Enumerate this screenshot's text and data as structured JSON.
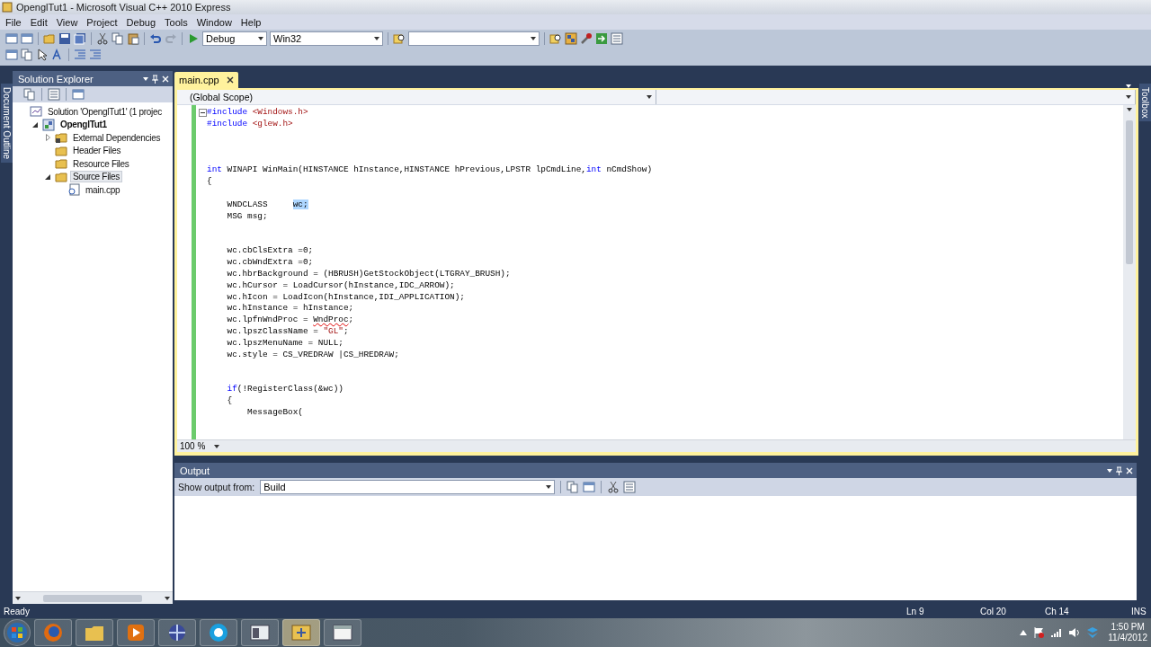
{
  "window": {
    "title": "OpenglTut1 - Microsoft Visual C++ 2010 Express"
  },
  "menu": [
    "File",
    "Edit",
    "View",
    "Project",
    "Debug",
    "Tools",
    "Window",
    "Help"
  ],
  "toolbar": {
    "configuration": "Debug",
    "platform": "Win32"
  },
  "side_tab_left": "Document Outline",
  "side_tab_right": "Toolbox",
  "solution_explorer": {
    "title": "Solution Explorer",
    "tree": [
      {
        "label": "Solution 'OpenglTut1' (1 projec",
        "kind": "solution",
        "selected": false,
        "children": [
          {
            "label": "OpenglTut1",
            "kind": "project",
            "expanded": true,
            "selected": false,
            "children": [
              {
                "label": "External Dependencies",
                "kind": "dependencies",
                "expanded": false,
                "selected": false
              },
              {
                "label": "Header Files",
                "kind": "folder",
                "selected": false
              },
              {
                "label": "Resource Files",
                "kind": "folder",
                "selected": false
              },
              {
                "label": "Source Files",
                "kind": "folder",
                "expanded": true,
                "selected": true,
                "children": [
                  {
                    "label": "main.cpp",
                    "kind": "file",
                    "selected": false
                  }
                ]
              }
            ]
          }
        ]
      }
    ]
  },
  "editor": {
    "tabs": [
      {
        "label": "main.cpp",
        "selected": true
      }
    ],
    "scope": "(Global Scope)",
    "zoom": "100 %",
    "lines": [
      {
        "kind": "code",
        "expanded": true,
        "tokens": [
          {
            "text": "#include",
            "kind": "keyword"
          },
          {
            "text": " <Windows.h>",
            "kind": "string"
          }
        ]
      },
      {
        "kind": "code",
        "tokens": [
          {
            "text": "#include",
            "kind": "keyword"
          },
          {
            "text": " <glew.h>",
            "kind": "string"
          }
        ]
      },
      {
        "kind": "blank"
      },
      {
        "kind": "blank"
      },
      {
        "kind": "blank"
      },
      {
        "kind": "code",
        "tokens": [
          {
            "text": "int",
            "kind": "keyword"
          },
          {
            "text": " WINAPI WinMain(HINSTANCE hInstance,HINSTANCE hPrevious,LPSTR lpCmdLine,",
            "kind": "plain"
          },
          {
            "text": "int",
            "kind": "keyword"
          },
          {
            "text": " nCmdShow)",
            "kind": "plain"
          }
        ]
      },
      {
        "kind": "code",
        "tokens": [
          {
            "text": "{",
            "kind": "plain"
          }
        ]
      },
      {
        "kind": "blank"
      },
      {
        "kind": "code",
        "tokens": [
          {
            "text": "    WNDCLASS     ",
            "kind": "plain"
          },
          {
            "text": "wc;",
            "kind": "selected"
          }
        ]
      },
      {
        "kind": "code",
        "tokens": [
          {
            "text": "    MSG msg;",
            "kind": "plain"
          }
        ]
      },
      {
        "kind": "blank"
      },
      {
        "kind": "blank"
      },
      {
        "kind": "code",
        "tokens": [
          {
            "text": "    wc.cbClsExtra =0;",
            "kind": "plain"
          }
        ]
      },
      {
        "kind": "code",
        "tokens": [
          {
            "text": "    wc.cbWndExtra =0;",
            "kind": "plain"
          }
        ]
      },
      {
        "kind": "code",
        "tokens": [
          {
            "text": "    wc.hbrBackground = (HBRUSH)GetStockObject(LTGRAY_BRUSH);",
            "kind": "plain"
          }
        ]
      },
      {
        "kind": "code",
        "tokens": [
          {
            "text": "    wc.hCursor = LoadCursor(hInstance,IDC_ARROW);",
            "kind": "plain"
          }
        ]
      },
      {
        "kind": "code",
        "tokens": [
          {
            "text": "    wc.hIcon = LoadIcon(hInstance,IDI_APPLICATION);",
            "kind": "plain"
          }
        ]
      },
      {
        "kind": "code",
        "tokens": [
          {
            "text": "    wc.hInstance = hInstance;",
            "kind": "plain"
          }
        ]
      },
      {
        "kind": "code",
        "tokens": [
          {
            "text": "    wc.lpfnWndProc = ",
            "kind": "plain"
          },
          {
            "text": "WndProc",
            "kind": "error"
          },
          {
            "text": ";",
            "kind": "plain"
          }
        ]
      },
      {
        "kind": "code",
        "tokens": [
          {
            "text": "    wc.lpszClassName = ",
            "kind": "plain"
          },
          {
            "text": "\"GL\"",
            "kind": "string"
          },
          {
            "text": ";",
            "kind": "plain"
          }
        ]
      },
      {
        "kind": "code",
        "tokens": [
          {
            "text": "    wc.lpszMenuName = NULL;",
            "kind": "plain"
          }
        ]
      },
      {
        "kind": "code",
        "tokens": [
          {
            "text": "    wc.style = CS_VREDRAW |CS_HREDRAW;",
            "kind": "plain"
          }
        ]
      },
      {
        "kind": "blank"
      },
      {
        "kind": "blank"
      },
      {
        "kind": "code",
        "tokens": [
          {
            "text": "    if",
            "kind": "keyword"
          },
          {
            "text": "(!RegisterClass(&wc))",
            "kind": "plain"
          }
        ]
      },
      {
        "kind": "code",
        "tokens": [
          {
            "text": "    {",
            "kind": "plain"
          }
        ]
      },
      {
        "kind": "code",
        "tokens": [
          {
            "text": "        MessageBox(",
            "kind": "plain"
          }
        ]
      }
    ]
  },
  "output": {
    "title": "Output",
    "show_from_label": "Show output from:",
    "source": "Build"
  },
  "status_bar": {
    "message": "Ready",
    "line": "Ln 9",
    "column": "Col 20",
    "char": "Ch 14",
    "mode": "INS"
  },
  "taskbar": {
    "time": "1:50 PM",
    "date": "11/4/2012"
  }
}
